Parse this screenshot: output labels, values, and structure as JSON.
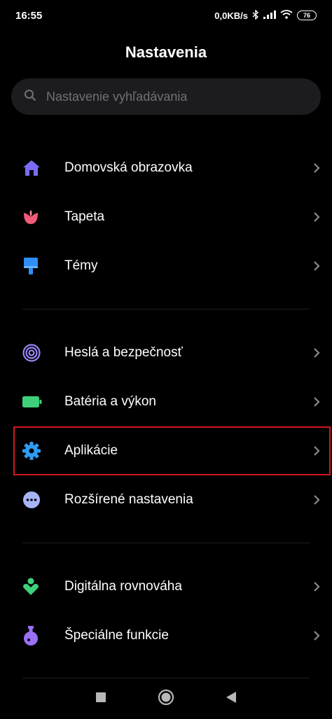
{
  "status_bar": {
    "time": "16:55",
    "network_speed": "0,0KB/s",
    "battery_level": "76"
  },
  "header": {
    "title": "Nastavenia"
  },
  "search": {
    "placeholder": "Nastavenie vyhľadávania"
  },
  "settings": {
    "items": [
      {
        "label": "Domovská obrazovka",
        "icon": "home-icon",
        "color": "#7b6cf6"
      },
      {
        "label": "Tapeta",
        "icon": "flower-icon",
        "color": "#f25a7a"
      },
      {
        "label": "Témy",
        "icon": "brush-icon",
        "color": "#2f8ef4"
      },
      {
        "label": "Heslá a bezpečnosť",
        "icon": "fingerprint-icon",
        "color": "#9a86f8"
      },
      {
        "label": "Batéria a výkon",
        "icon": "battery-icon",
        "color": "#3ed07a"
      },
      {
        "label": "Aplikácie",
        "icon": "gear-icon",
        "color": "#2f9cf4"
      },
      {
        "label": "Rozšírené nastavenia",
        "icon": "more-dots-icon",
        "color": "#a8b4f8"
      },
      {
        "label": "Digitálna rovnováha",
        "icon": "wellbeing-icon",
        "color": "#3ed07a"
      },
      {
        "label": "Špeciálne funkcie",
        "icon": "flask-icon",
        "color": "#9a70f6"
      }
    ]
  },
  "highlight_color": "#d0151e"
}
